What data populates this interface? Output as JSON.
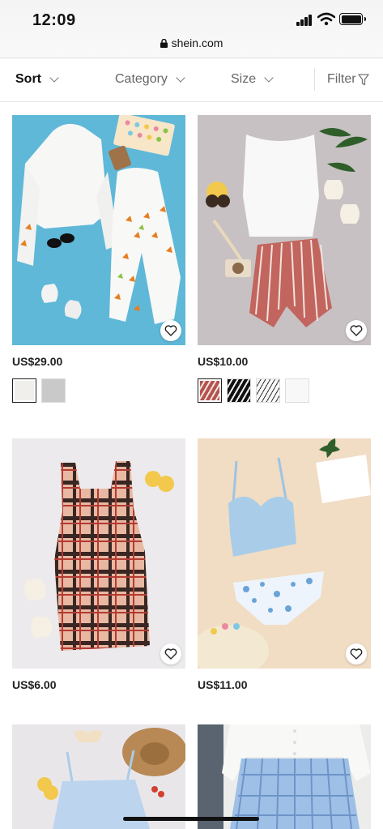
{
  "status": {
    "time": "12:09",
    "url": "shein.com"
  },
  "filters": {
    "sort": "Sort",
    "category": "Category",
    "size": "Size",
    "filter": "Filter"
  },
  "products": [
    {
      "price": "US$29.00",
      "swatches": [
        "white",
        "gray-heather"
      ],
      "image": "white hoodie and joggers with butterflies on blue background"
    },
    {
      "price": "US$10.00",
      "swatches": [
        "red-stripe",
        "black-stripe",
        "white-black-stripe",
        "white"
      ],
      "image": "white tank top and red striped shorts"
    },
    {
      "price": "US$6.00",
      "swatches": [],
      "image": "plaid sleeveless bodycon dress"
    },
    {
      "price": "US$11.00",
      "swatches": [],
      "image": "blue bikini top with floral bottoms"
    },
    {
      "price": "",
      "swatches": [],
      "image": "blue gingham dress with straw hat"
    },
    {
      "price": "",
      "swatches": [],
      "image": "white cardigan with blue plaid skirt"
    }
  ],
  "colors": {
    "text": "#222222",
    "muted": "#666666",
    "blue_bg": "#5fb8d8",
    "beige_bg": "#f1dcc4"
  }
}
